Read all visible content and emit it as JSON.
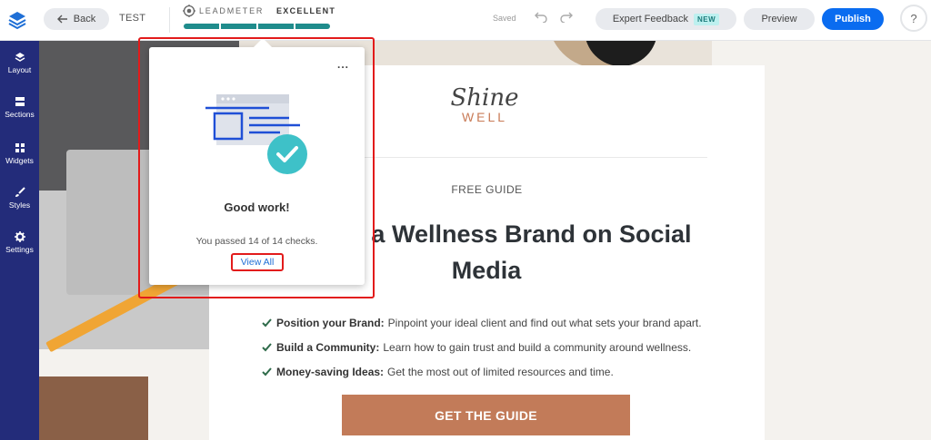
{
  "topbar": {
    "back_label": "Back",
    "page_name": "TEST",
    "leadmeter": {
      "label": "LEADMETER",
      "rating": "EXCELLENT",
      "segments": 4,
      "filled": 4
    },
    "saved_label": "Saved",
    "expert_label": "Expert Feedback",
    "new_badge": "NEW",
    "preview_label": "Preview",
    "publish_label": "Publish",
    "help_label": "?"
  },
  "sidebar": {
    "items": [
      {
        "label": "Layout",
        "icon": "layers-icon"
      },
      {
        "label": "Sections",
        "icon": "sections-icon"
      },
      {
        "label": "Widgets",
        "icon": "widgets-icon"
      },
      {
        "label": "Styles",
        "icon": "brush-icon"
      },
      {
        "label": "Settings",
        "icon": "gear-icon"
      }
    ]
  },
  "page": {
    "brand_script": "Shine",
    "brand_caps": "WELL",
    "eyebrow": "FREE GUIDE",
    "headline": "o Build a Wellness Brand on Social Media",
    "bullets": [
      {
        "bold": "Position your Brand:",
        "text": "Pinpoint your ideal client and find out what sets your brand apart."
      },
      {
        "bold": "Build a Community:",
        "text": "Learn how to gain trust and build a community around wellness."
      },
      {
        "bold": "Money-saving Ideas:",
        "text": "Get the most out of limited resources and time."
      }
    ],
    "cta_label": "GET THE GUIDE"
  },
  "popup": {
    "menu_label": "...",
    "title": "Good work!",
    "summary": "You passed 14 of 14 checks.",
    "link_label": "View All"
  },
  "colors": {
    "sidebar_bg": "#232c7a",
    "publish": "#0a6cf0",
    "leadmeter": "#1f8c8c",
    "cta": "#c27b59",
    "highlight": "#e21b1b"
  }
}
